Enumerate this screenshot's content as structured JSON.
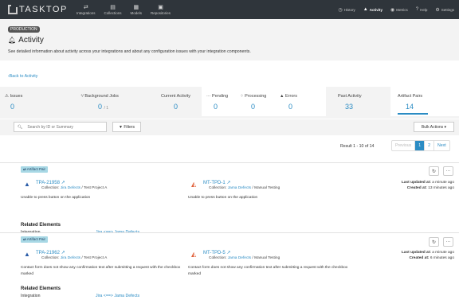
{
  "nav": {
    "brand": "TASKTOP",
    "items": [
      {
        "label": "Integrations",
        "icon": "⇄"
      },
      {
        "label": "Collections",
        "icon": "▤"
      },
      {
        "label": "Models",
        "icon": "▦"
      },
      {
        "label": "Repositories",
        "icon": "▣"
      }
    ],
    "right": [
      {
        "label": "History",
        "icon": "◷"
      },
      {
        "label": "Activity",
        "icon": "▲"
      },
      {
        "label": "Metrics",
        "icon": "◉"
      },
      {
        "label": "Help",
        "icon": "?"
      },
      {
        "label": "Settings",
        "icon": "⚙"
      }
    ]
  },
  "header": {
    "env": "PRODUCTION",
    "title": "Activity",
    "description": "See detailed information about activity across your integrations and about any configuration issues with your integration components."
  },
  "back_link": "Back to Activity",
  "stats": {
    "issues": {
      "label": "Issues",
      "value": "0"
    },
    "background_jobs": {
      "label": "Background Jobs",
      "value": "0",
      "of": "/ 1"
    },
    "current_activity": {
      "label": "Current Activity",
      "value": "0"
    },
    "pending": {
      "label": "Pending",
      "value": "0"
    },
    "processing": {
      "label": "Processing",
      "value": "0"
    },
    "errors": {
      "label": "Errors",
      "value": "0"
    },
    "past_activity": {
      "label": "Past Activity",
      "value": "33"
    },
    "artifact_pairs": {
      "label": "Artifact Pairs",
      "value": "14"
    }
  },
  "toolbar": {
    "search_placeholder": "Search by ID or Summary",
    "filters_label": "Filters",
    "bulk_label": "Bulk Actions"
  },
  "pagination": {
    "result_text": "Result 1 - 10 of 14",
    "previous": "Previous",
    "pages": [
      "1",
      "2"
    ],
    "next": "Next"
  },
  "cards": [
    {
      "tag": "Artifact Pair",
      "left": {
        "id": "TPA-21958",
        "collection_prefix": "Collection:",
        "collection_link": "Jira Defects",
        "collection_suffix": "/ Test Project A",
        "description": "Unable to press button on the application"
      },
      "right": {
        "id": "MT-TPD-1",
        "collection_prefix": "Collection:",
        "collection_link": "Jama Defects",
        "collection_suffix": "/ Manual Testing",
        "description": "Unable to press button on the application"
      },
      "last_updated_label": "Last updated at:",
      "last_updated": "a minute ago",
      "created_label": "Created at:",
      "created": "13 minutes ago",
      "related_heading": "Related Elements",
      "integration_label": "Integration",
      "integration_link": "Jira <==> Jama Defects"
    },
    {
      "tag": "Artifact Pair",
      "left": {
        "id": "TPA-21962",
        "collection_prefix": "Collection:",
        "collection_link": "Jira Defects",
        "collection_suffix": "/ Test Project A",
        "description": "Contact form does not show any confirmation text after submitting a request with the checkbox marked"
      },
      "right": {
        "id": "MT-TPD-5",
        "collection_prefix": "Collection:",
        "collection_link": "Jama Defects",
        "collection_suffix": "/ Manual Testing",
        "description": "Contact form does not show any confirmation text after submitting a request with the checkbox marked"
      },
      "last_updated_label": "Last updated at:",
      "last_updated": "a minute ago",
      "created_label": "Created at:",
      "created": "6 minutes ago",
      "related_heading": "Related Elements",
      "integration_label": "Integration",
      "integration_link": "Jira <==> Jama Defects"
    }
  ],
  "colors": {
    "accent": "#2b8cc4",
    "nav_bg": "#2f353b",
    "tag_bg": "#a8d8e5"
  }
}
